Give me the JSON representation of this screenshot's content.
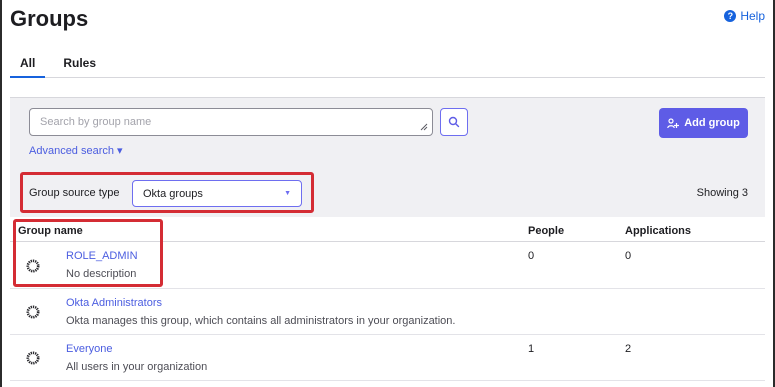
{
  "header": {
    "title": "Groups",
    "help_label": "Help"
  },
  "tabs": [
    {
      "label": "All",
      "active": true
    },
    {
      "label": "Rules",
      "active": false
    }
  ],
  "search": {
    "placeholder": "Search by group name",
    "value": ""
  },
  "add_group_label": "Add group",
  "advanced_search_label": "Advanced search ▾",
  "filter": {
    "source_type_label": "Group source type",
    "source_type_value": "Okta groups",
    "showing_label": "Showing 3"
  },
  "table": {
    "columns": [
      "Group name",
      "People",
      "Applications"
    ],
    "rows": [
      {
        "name": "ROLE_ADMIN",
        "description": "No description",
        "people": "0",
        "applications": "0"
      },
      {
        "name": "Okta Administrators",
        "description": "Okta manages this group, which contains all administrators in your organization.",
        "people": "",
        "applications": ""
      },
      {
        "name": "Everyone",
        "description": "All users in your organization",
        "people": "1",
        "applications": "2"
      }
    ]
  },
  "colors": {
    "accent": "#5e5ce6",
    "link": "#4b5de0",
    "highlight": "#d42c34",
    "help": "#1662dd"
  },
  "icons": {
    "help": "help-circle-icon",
    "search": "search-icon",
    "add": "add-user-icon",
    "group": "group-gear-icon"
  }
}
